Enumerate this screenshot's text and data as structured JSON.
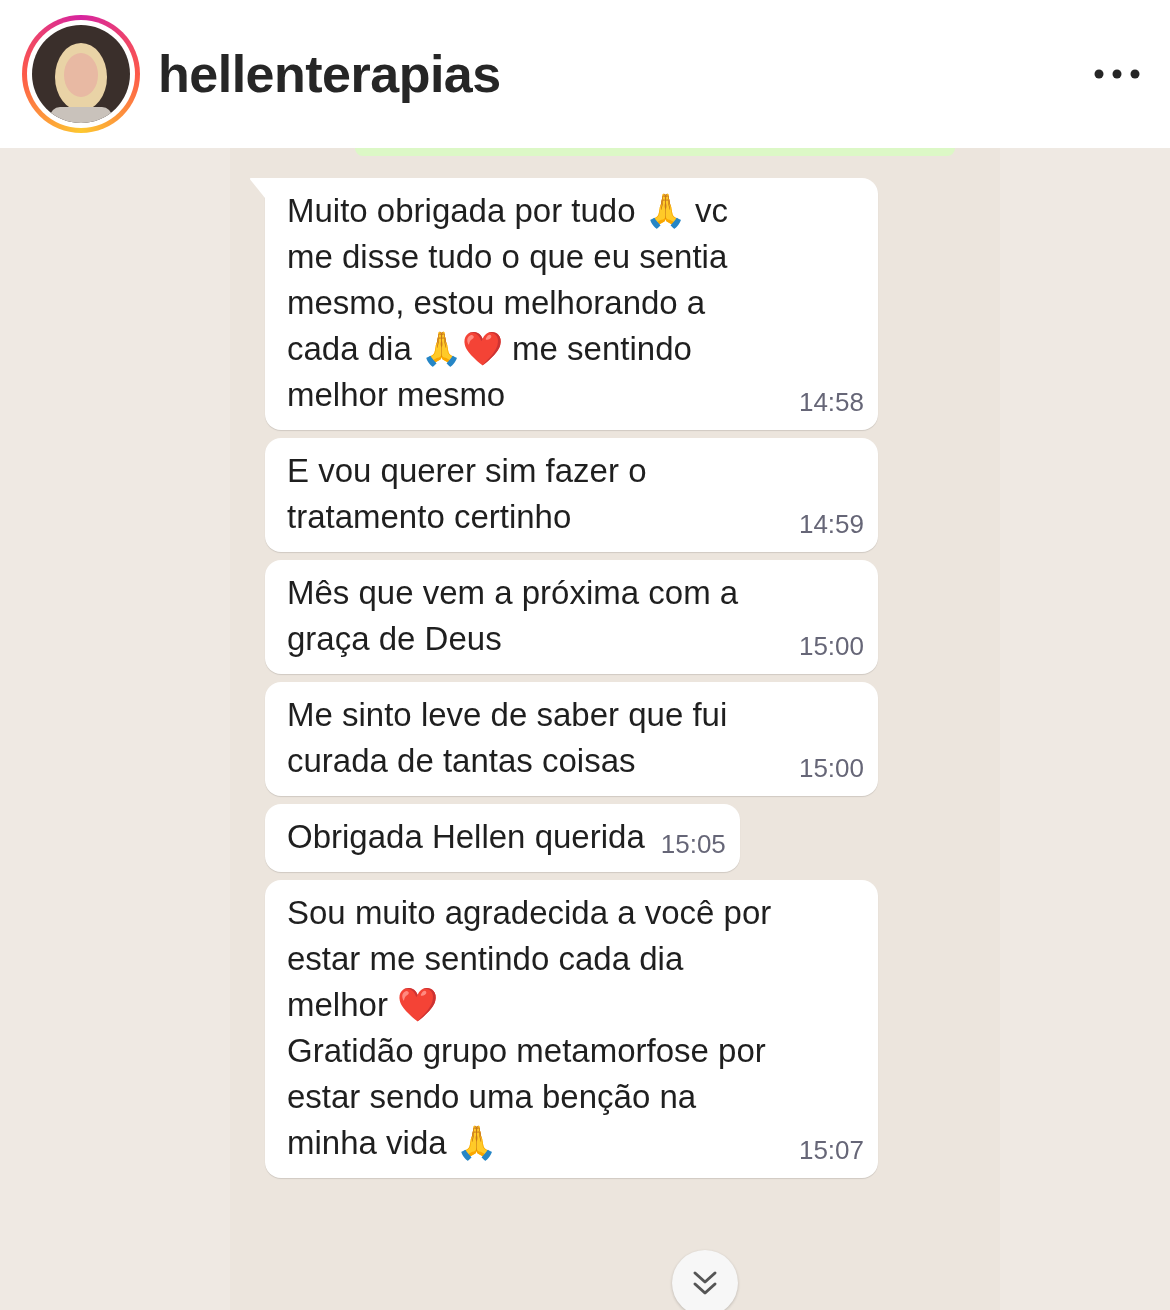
{
  "header": {
    "username": "hellenterapias"
  },
  "messages": [
    {
      "text": "Muito obrigada por tudo 🙏 vc\nme disse tudo o que eu sentia\nmesmo, estou melhorando a\ncada dia 🙏❤️ me sentindo\nmelhor mesmo",
      "time": "14:58",
      "tail": true
    },
    {
      "text": "E vou querer sim fazer o\ntratamento certinho",
      "time": "14:59",
      "tail": false
    },
    {
      "text": "Mês que vem a próxima com a\ngraça de Deus",
      "time": "15:00",
      "tail": false
    },
    {
      "text": "Me sinto leve de saber que fui\ncurada de tantas coisas",
      "time": "15:00",
      "tail": false
    },
    {
      "text": "Obrigada Hellen querida",
      "time": "15:05",
      "tail": false
    },
    {
      "text": "Sou muito agradecida a você por\nestar me sentindo cada dia\nmelhor ❤️\nGratidão grupo metamorfose por\nestar sendo uma benção na\nminha vida 🙏",
      "time": "15:07",
      "tail": false
    }
  ]
}
